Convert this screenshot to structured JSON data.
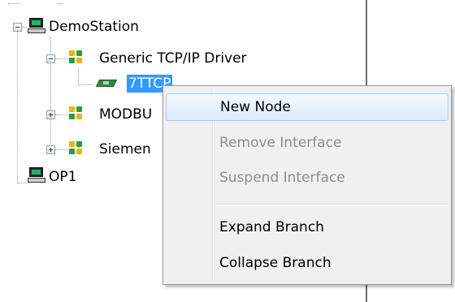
{
  "tree": {
    "nodes": [
      {
        "label": "DemoStation",
        "icon": "computer-icon",
        "expanded": true
      },
      {
        "label": "Generic TCP/IP Driver",
        "icon": "driver-network-icon",
        "expanded": true
      },
      {
        "label": "7TTCP",
        "icon": "network-card-icon",
        "selected": true
      },
      {
        "label": "MODBU",
        "icon": "driver-network-icon",
        "expanded": false
      },
      {
        "label": "Siemen",
        "icon": "driver-network-icon",
        "expanded": false
      },
      {
        "label": "OP1",
        "icon": "computer-icon"
      }
    ]
  },
  "context_menu": {
    "items": [
      {
        "label": "New Node",
        "enabled": true,
        "highlighted": true
      },
      {
        "label": "Remove Interface",
        "enabled": false
      },
      {
        "label": "Suspend Interface",
        "enabled": false
      },
      {
        "label": "Expand Branch",
        "enabled": true
      },
      {
        "label": "Collapse Branch",
        "enabled": true
      }
    ]
  },
  "colors": {
    "selection": "#3399ff",
    "menu_background": "#f0f0f0",
    "menu_highlight": "#dbeafb",
    "disabled_text": "#8d8d8d"
  }
}
